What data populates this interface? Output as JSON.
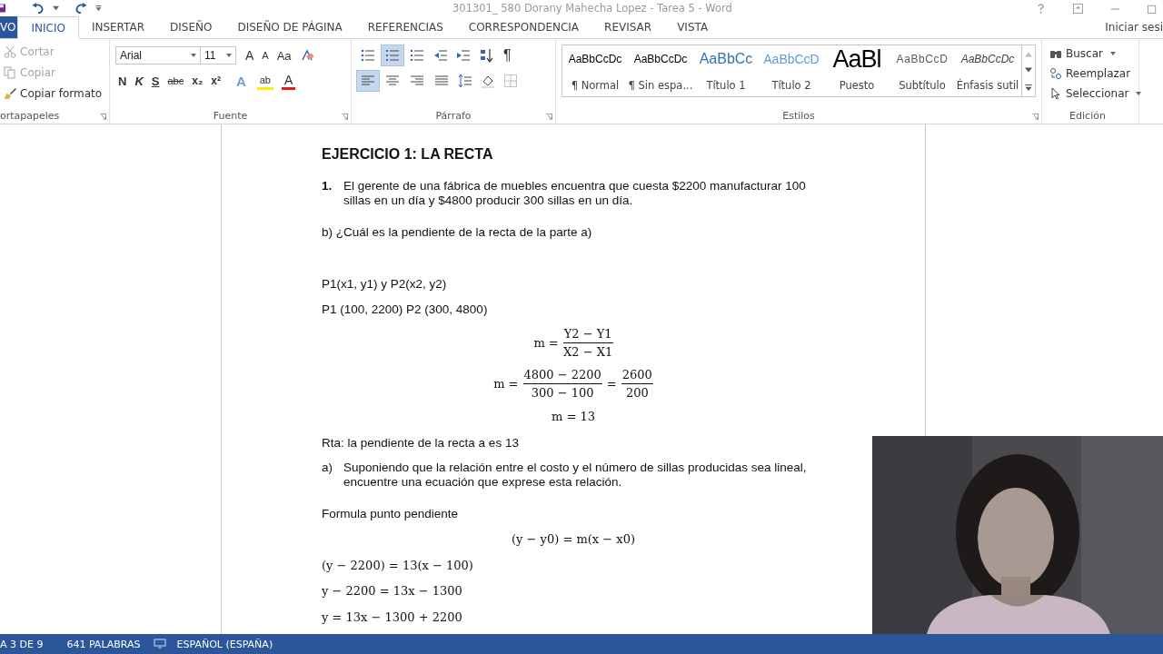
{
  "window": {
    "title": "301301_ 580 Dorany Mahecha Lopez - Tarea 5 - Word"
  },
  "tabs": [
    {
      "label": "VO",
      "kind": "file",
      "selected": false
    },
    {
      "label": "INICIO",
      "selected": true
    },
    {
      "label": "INSERTAR",
      "selected": false
    },
    {
      "label": "DISEÑO",
      "selected": false
    },
    {
      "label": "DISEÑO DE PÁGINA",
      "selected": false
    },
    {
      "label": "REFERENCIAS",
      "selected": false
    },
    {
      "label": "CORRESPONDENCIA",
      "selected": false
    },
    {
      "label": "REVISAR",
      "selected": false
    },
    {
      "label": "VISTA",
      "selected": false
    }
  ],
  "account": "Iniciar sesi",
  "ribbon": {
    "clipboard": {
      "label": "ortapapeles",
      "items": [
        {
          "label": "Cortar",
          "kind": "cut",
          "disabled": true
        },
        {
          "label": "Copiar",
          "kind": "copy",
          "disabled": true
        },
        {
          "label": "Copiar formato",
          "kind": "brush",
          "disabled": false
        }
      ]
    },
    "font": {
      "label": "Fuente",
      "name": "Arial",
      "size": "11",
      "top_buttons": [
        {
          "kind": "grow",
          "label": "A"
        },
        {
          "kind": "shrink",
          "label": "A"
        },
        {
          "kind": "case",
          "label": "Aa"
        }
      ],
      "bottom_buttons": [
        {
          "kind": "bold",
          "label": "N"
        },
        {
          "kind": "italic",
          "label": "K"
        },
        {
          "kind": "underline",
          "label": "S"
        },
        {
          "kind": "strike",
          "label": "abc"
        },
        {
          "kind": "sub",
          "label": "x₂"
        },
        {
          "kind": "sup",
          "label": "x²"
        },
        {
          "kind": "effects",
          "label": "A"
        },
        {
          "kind": "highlight",
          "label": "ab"
        },
        {
          "kind": "color",
          "label": "A"
        }
      ]
    },
    "paragraph": {
      "label": "Párrafo",
      "pilcrow": "¶",
      "list_buttons": [
        {
          "kind": "bullets",
          "selected": false
        },
        {
          "kind": "numbering",
          "selected": true
        },
        {
          "kind": "multilevel",
          "selected": false
        }
      ],
      "align_buttons": [
        {
          "kind": "left",
          "selected": true
        },
        {
          "kind": "center",
          "selected": false
        },
        {
          "kind": "right",
          "selected": false
        },
        {
          "kind": "justify",
          "selected": false
        }
      ]
    },
    "styles": {
      "label": "Estilos",
      "items": [
        {
          "preview": "AaBbCcDc",
          "name": "¶ Normal",
          "kind": "normal"
        },
        {
          "preview": "AaBbCcDc",
          "name": "¶ Sin espa...",
          "kind": "nospace"
        },
        {
          "preview": "AaBbCc",
          "name": "Título 1",
          "kind": "title1"
        },
        {
          "preview": "AaBbCcD",
          "name": "Título 2",
          "kind": "title2"
        },
        {
          "preview": "AaBl",
          "name": "Puesto",
          "kind": "puesto"
        },
        {
          "preview": "AaBbCcD",
          "name": "Subtítulo",
          "kind": "subtitle"
        },
        {
          "preview": "AaBbCcDc",
          "name": "Énfasis sutil",
          "kind": "emphasis"
        }
      ]
    },
    "editing": {
      "label": "Edición",
      "items": [
        {
          "label": "Buscar",
          "kind": "find"
        },
        {
          "label": "Reemplazar",
          "kind": "replace"
        },
        {
          "label": "Seleccionar",
          "kind": "select"
        }
      ]
    }
  },
  "document": [
    {
      "kind": "heading",
      "text": "EJERCICIO 1: LA RECTA"
    },
    {
      "kind": "list",
      "marker": "1.",
      "marker_bold": true,
      "text": "El gerente de una fábrica de muebles encuentra que cuesta $2200 manufacturar 100 sillas en un día y $4800 producir 300 sillas en un día."
    },
    {
      "kind": "para",
      "text": "b) ¿Cuál es la pendiente de la recta de la parte a)"
    },
    {
      "kind": "para",
      "text": "P1(x1, y1) y P2(x2, y2)"
    },
    {
      "kind": "para",
      "text": "P1 (100, 2200) P2 (300, 4800)"
    },
    {
      "kind": "math_center",
      "parts": [
        {
          "t": "m ="
        },
        {
          "num": "Y2 − Y1",
          "den": "X2 − X1"
        }
      ]
    },
    {
      "kind": "math_center",
      "parts": [
        {
          "t": "m ="
        },
        {
          "num": "4800 − 2200",
          "den": "300 − 100"
        },
        {
          "t": "="
        },
        {
          "num": "2600",
          "den": "200"
        }
      ]
    },
    {
      "kind": "math_center",
      "parts": [
        {
          "t": "m = 13"
        }
      ]
    },
    {
      "kind": "para",
      "text": "Rta: la pendiente de la recta a es 13"
    },
    {
      "kind": "list",
      "marker": "a)",
      "marker_bold": false,
      "text": "Suponiendo que la relación entre el costo y el número de sillas producidas sea lineal, encuentre una ecuación que exprese esta relación."
    },
    {
      "kind": "para",
      "text": "Formula punto pendiente"
    },
    {
      "kind": "math_center",
      "parts": [
        {
          "t": "(y − y0) = m(x − x0)"
        }
      ]
    },
    {
      "kind": "math_left",
      "parts": [
        {
          "t": "(y − 2200) = 13(x − 100)"
        }
      ]
    },
    {
      "kind": "math_left",
      "parts": [
        {
          "t": "y − 2200 = 13x − 1300"
        }
      ]
    },
    {
      "kind": "math_left",
      "parts": [
        {
          "t": "y = 13x − 1300 + 2200"
        }
      ]
    }
  ],
  "status_bar": {
    "page": "A 3 DE 9",
    "words": "641 PALABRAS",
    "language": "ESPAÑOL (ESPAÑA)"
  }
}
